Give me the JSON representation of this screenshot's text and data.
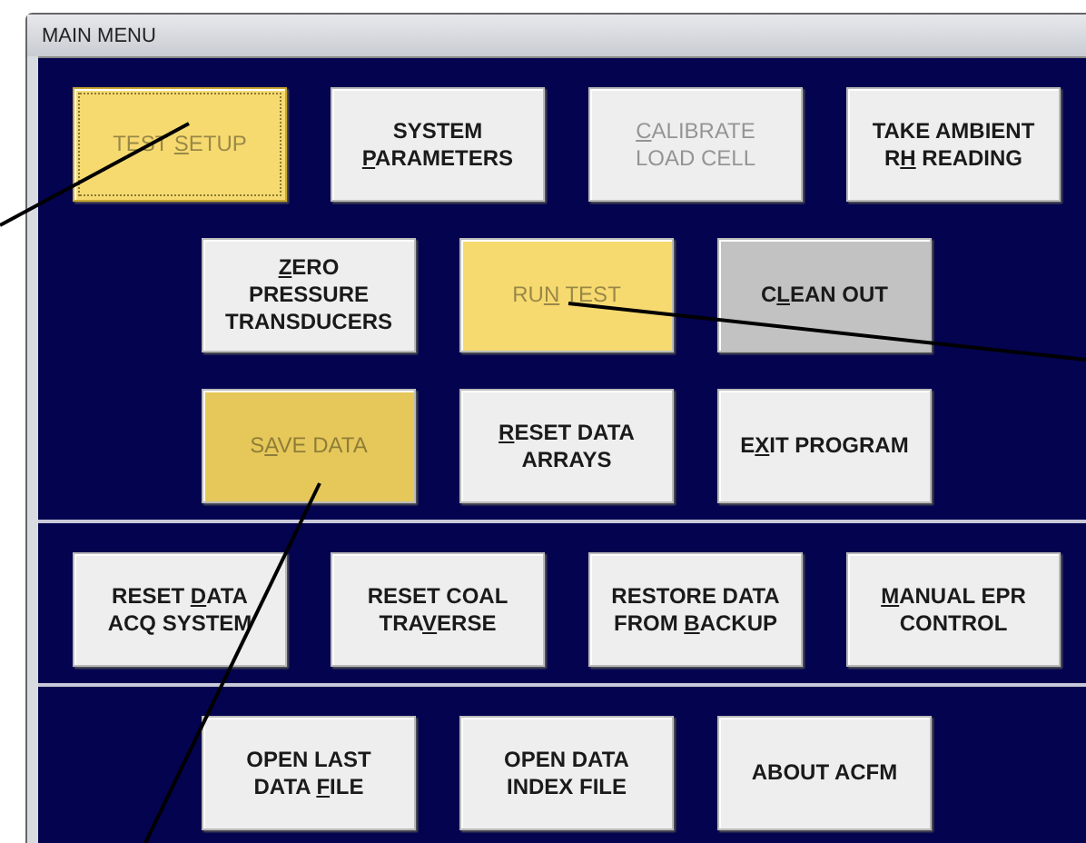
{
  "window": {
    "title": "MAIN MENU"
  },
  "sections": [
    {
      "rows": [
        [
          {
            "pre": "TEST ",
            "key": "S",
            "post": "ETUP",
            "color": "#f6da70",
            "disabled": true,
            "focused": true
          },
          {
            "pre": "SYSTEM\n",
            "key": "P",
            "post": "ARAMETERS",
            "color": "#eeeeee",
            "disabled": false,
            "focused": false
          },
          {
            "key": "C",
            "post": "ALIBRATE\nLOAD CELL",
            "color": "#eeeeee",
            "disabled": true,
            "focused": false
          },
          {
            "pre": "TAKE AMBIENT\nR",
            "key": "H",
            "post": " READING",
            "color": "#eeeeee",
            "disabled": false,
            "focused": false
          }
        ],
        [
          {
            "key": "Z",
            "post": "ERO\nPRESSURE\nTRANSDUCERS",
            "color": "#eeeeee",
            "disabled": false,
            "focused": false
          },
          {
            "pre": "RU",
            "key": "N",
            "post": " TEST",
            "color": "#f6da70",
            "disabled": true,
            "focused": false
          },
          {
            "pre": "C",
            "key": "L",
            "post": "EAN OUT",
            "color": "#c2c2c2",
            "disabled": false,
            "focused": false
          }
        ],
        [
          {
            "pre": "S",
            "key": "A",
            "post": "VE DATA",
            "color": "#e6c85a",
            "disabled": true,
            "focused": false
          },
          {
            "key": "R",
            "post": "ESET DATA\nARRAYS",
            "color": "#eeeeee",
            "disabled": false,
            "focused": false
          },
          {
            "pre": "E",
            "key": "X",
            "post": "IT PROGRAM",
            "color": "#eeeeee",
            "disabled": false,
            "focused": false
          }
        ]
      ]
    },
    {
      "rows": [
        [
          {
            "pre": "RESET ",
            "key": "D",
            "post": "ATA\nACQ SYSTEM",
            "color": "#eeeeee",
            "disabled": false,
            "focused": false
          },
          {
            "pre": "RESET COAL\nTRA",
            "key": "V",
            "post": "ERSE",
            "color": "#eeeeee",
            "disabled": false,
            "focused": false
          },
          {
            "pre": "RESTORE DATA\nFROM ",
            "key": "B",
            "post": "ACKUP",
            "color": "#eeeeee",
            "disabled": false,
            "focused": false
          },
          {
            "key": "M",
            "post": "ANUAL EPR\nCONTROL",
            "color": "#eeeeee",
            "disabled": false,
            "focused": false
          }
        ]
      ]
    },
    {
      "rows": [
        [
          {
            "pre": "OPEN LAST\nDATA ",
            "key": "F",
            "post": "ILE",
            "color": "#eeeeee",
            "disabled": false,
            "focused": false
          },
          {
            "pre": "OPEN DATA\nINDEX FILE",
            "color": "#eeeeee",
            "disabled": false,
            "focused": false
          },
          {
            "pre": "ABOUT ACFM",
            "color": "#eeeeee",
            "disabled": false,
            "focused": false
          }
        ]
      ]
    }
  ]
}
